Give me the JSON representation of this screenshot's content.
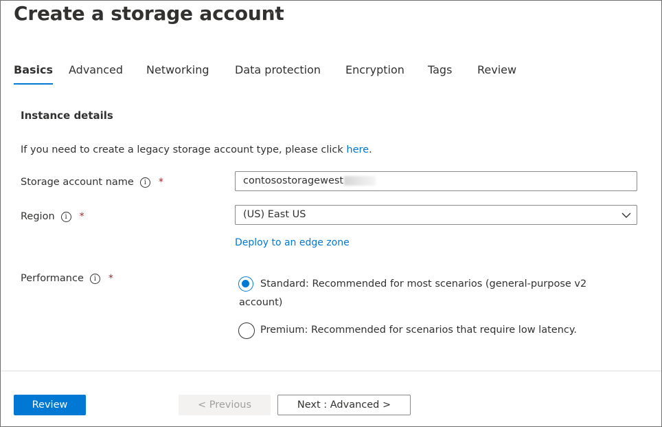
{
  "header": {
    "title": "Create a storage account",
    "more_label": "···"
  },
  "tabs": [
    {
      "label": "Basics",
      "active": true
    },
    {
      "label": "Advanced"
    },
    {
      "label": "Networking"
    },
    {
      "label": "Data protection"
    },
    {
      "label": "Encryption"
    },
    {
      "label": "Tags"
    },
    {
      "label": "Review"
    }
  ],
  "instance": {
    "heading": "Instance details",
    "legacy_text": "If you need to create a legacy storage account type, please click ",
    "legacy_link": "here",
    "legacy_suffix": "."
  },
  "fields": {
    "storage_name": {
      "label": "Storage account name",
      "required_mark": "*",
      "value": "contosostoragewest"
    },
    "region": {
      "label": "Region",
      "required_mark": "*",
      "value": "(US) East US",
      "edge_link": "Deploy to an edge zone"
    },
    "performance": {
      "label": "Performance",
      "required_mark": "*",
      "options": [
        {
          "label": "Standard: Recommended for most scenarios (general-purpose v2",
          "label_line2": "account)",
          "checked": true
        },
        {
          "label": "Premium: Recommended for scenarios that require low latency.",
          "checked": false
        }
      ]
    }
  },
  "info_glyph": "i",
  "footer": {
    "review_label": "Review",
    "previous_label": "< Previous",
    "next_label": "Next : Advanced >"
  },
  "colors": {
    "accent": "#0078d4",
    "required": "#a4262c"
  }
}
